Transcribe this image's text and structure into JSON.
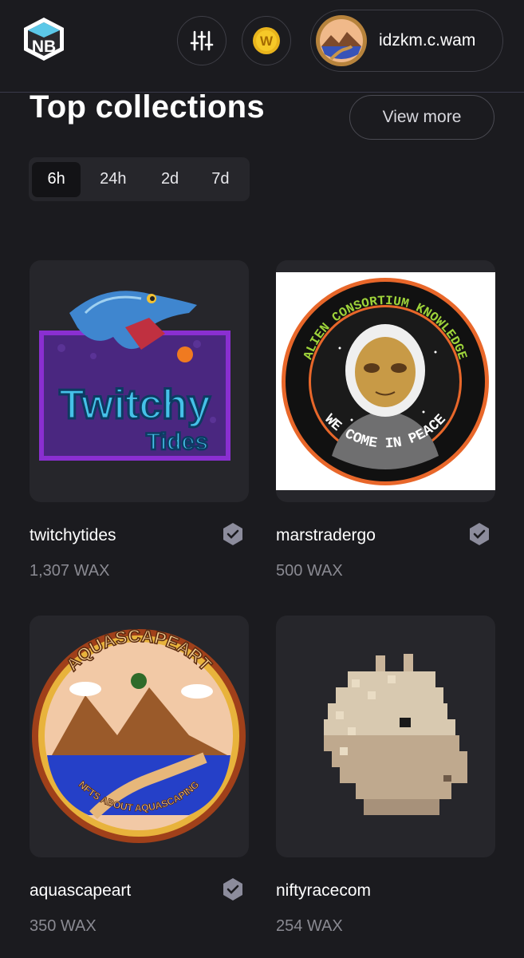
{
  "header": {
    "logo_text": "NB",
    "account_name": "idzkm.c.wam",
    "wax_badge": "W"
  },
  "section": {
    "title": "Top collections",
    "view_more": "View more",
    "tabs": [
      {
        "label": "6h",
        "active": true
      },
      {
        "label": "24h",
        "active": false
      },
      {
        "label": "2d",
        "active": false
      },
      {
        "label": "7d",
        "active": false
      }
    ]
  },
  "collections": [
    {
      "name": "twitchytides",
      "volume": "1,307 WAX",
      "verified": true,
      "image_text": [
        "Twitchy",
        "Tides"
      ]
    },
    {
      "name": "marstradergo",
      "volume": "500 WAX",
      "verified": true,
      "image_text": [
        "ALIEN CONSORTIUM KNOWLEDGE",
        "WE COME IN PEACE"
      ]
    },
    {
      "name": "aquascapeart",
      "volume": "350 WAX",
      "verified": true,
      "image_text": [
        "AQUASCAPEART",
        "NFTS ABOUT AQUASCAPING"
      ]
    },
    {
      "name": "niftyracecom",
      "volume": "254 WAX",
      "verified": false,
      "image_text": []
    }
  ],
  "colors": {
    "background": "#1b1b1f",
    "card": "#26262b",
    "muted_text": "#8a8a92",
    "verified_badge": "#8c8c9c"
  }
}
